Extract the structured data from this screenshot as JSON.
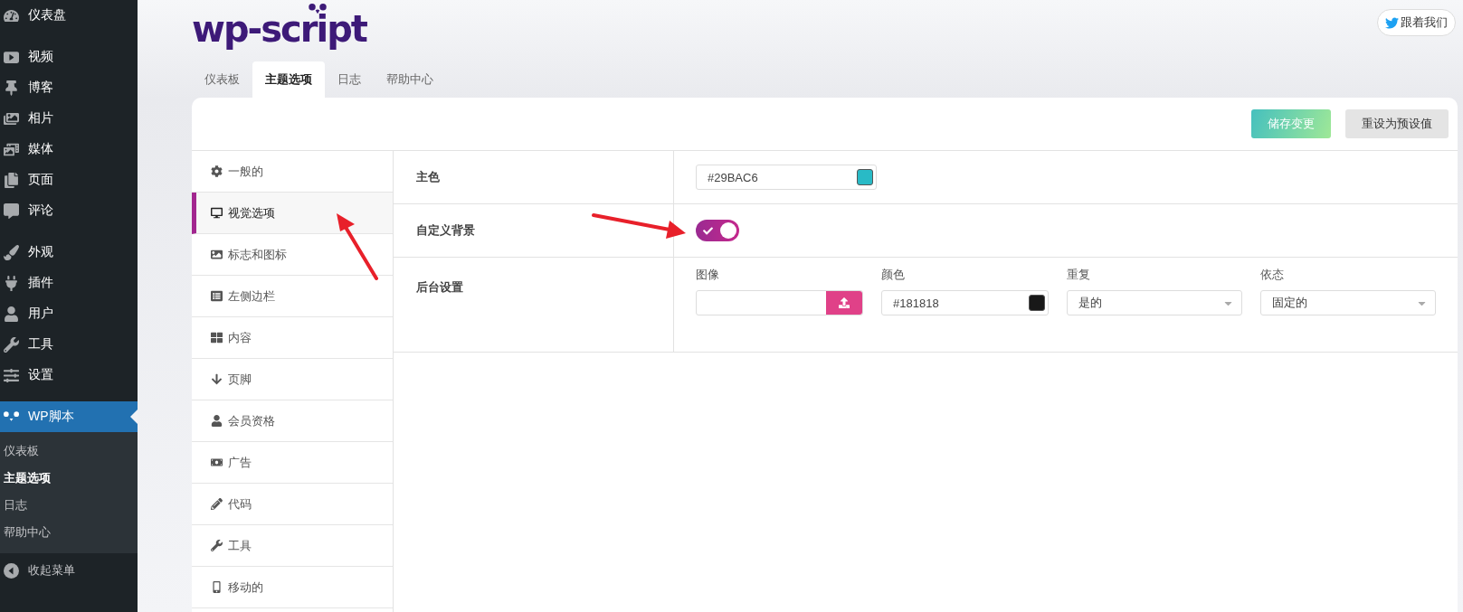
{
  "admin_menu": {
    "items": [
      {
        "label": "仪表盘",
        "selected": false,
        "group_start": false
      },
      {
        "label": "视频",
        "selected": false,
        "group_start": true
      },
      {
        "label": "博客",
        "selected": false,
        "group_start": false
      },
      {
        "label": "相片",
        "selected": false,
        "group_start": false
      },
      {
        "label": "媒体",
        "selected": false,
        "group_start": false
      },
      {
        "label": "页面",
        "selected": false,
        "group_start": false
      },
      {
        "label": "评论",
        "selected": false,
        "group_start": false
      },
      {
        "label": "外观",
        "selected": false,
        "group_start": true
      },
      {
        "label": "插件",
        "selected": false,
        "group_start": false
      },
      {
        "label": "用户",
        "selected": false,
        "group_start": false
      },
      {
        "label": "工具",
        "selected": false,
        "group_start": false
      },
      {
        "label": "设置",
        "selected": false,
        "group_start": false
      },
      {
        "label": "WP脚本",
        "selected": true,
        "group_start": true
      }
    ],
    "submenu": [
      {
        "label": "仪表板",
        "selected": false
      },
      {
        "label": "主题选项",
        "selected": true
      },
      {
        "label": "日志",
        "selected": false
      },
      {
        "label": "帮助中心",
        "selected": false
      }
    ],
    "collapse": "收起菜单"
  },
  "logo": "wp-script",
  "follow_button": "跟着我们",
  "tabs": [
    {
      "label": "仪表板",
      "selected": false
    },
    {
      "label": "主题选项",
      "selected": true
    },
    {
      "label": "日志",
      "selected": false
    },
    {
      "label": "帮助中心",
      "selected": false
    }
  ],
  "actions": {
    "save": "储存变更",
    "reset": "重设为预设值"
  },
  "options_menu": [
    {
      "label": "一般的",
      "selected": false
    },
    {
      "label": "视觉选项",
      "selected": true
    },
    {
      "label": "标志和图标",
      "selected": false
    },
    {
      "label": "左侧边栏",
      "selected": false
    },
    {
      "label": "内容",
      "selected": false
    },
    {
      "label": "页脚",
      "selected": false
    },
    {
      "label": "会员资格",
      "selected": false
    },
    {
      "label": "广告",
      "selected": false
    },
    {
      "label": "代码",
      "selected": false
    },
    {
      "label": "工具",
      "selected": false
    },
    {
      "label": "移动的",
      "selected": false
    }
  ],
  "settings": {
    "primary_color": {
      "label": "主色",
      "value": "#29BAC6",
      "color": "#29bac6"
    },
    "custom_background": {
      "label": "自定义背景",
      "on": true
    },
    "background": {
      "label": "后台设置",
      "fields": [
        {
          "kind": "upload",
          "label": "图像"
        },
        {
          "kind": "color",
          "label": "颜色",
          "value": "#181818",
          "color": "#181818"
        },
        {
          "kind": "select",
          "label": "重复",
          "value": "是的"
        },
        {
          "kind": "select",
          "label": "依态",
          "value": "固定的"
        }
      ]
    }
  }
}
